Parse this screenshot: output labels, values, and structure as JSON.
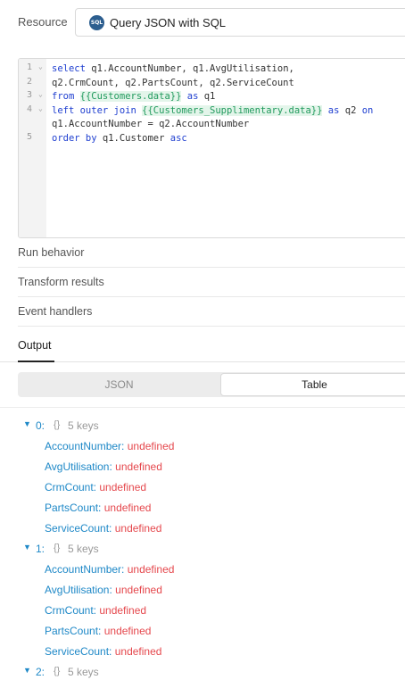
{
  "resource": {
    "label": "Resource",
    "badge": "SQL",
    "name": "Query JSON with SQL"
  },
  "editor": {
    "lines": [
      {
        "num": "1",
        "fold": "⌄"
      },
      {
        "num": "2",
        "fold": ""
      },
      {
        "num": "3",
        "fold": "⌄"
      },
      {
        "num": "4",
        "fold": "⌄"
      },
      {
        "num": "5",
        "fold": ""
      }
    ],
    "code": {
      "l1_kw": "select",
      "l1_rest": " q1.AccountNumber, q1.AvgUtilisation,",
      "l2": "q2.CrmCount, q2.PartsCount, q2.ServiceCount",
      "l3_kw": "from",
      "l3_tpl": "{{Customers.data}}",
      "l3_kw2": "as",
      "l3_rest": " q1",
      "l4_kw": "left outer join",
      "l4_tpl": "{{Customers_Supplimentary.data}}",
      "l4_kw2": "as",
      "l4_mid": " q2 ",
      "l4_kw3": "on",
      "l4b": "q1.AccountNumber = q2.AccountNumber",
      "l5_kw": "order by",
      "l5_mid": " q1.Customer ",
      "l5_kw2": "asc"
    }
  },
  "sections": {
    "run_behavior": "Run behavior",
    "transform_results": "Transform results",
    "event_handlers": "Event handlers"
  },
  "output": {
    "tab": "Output",
    "toggle_json": "JSON",
    "toggle_table": "Table"
  },
  "tree": {
    "arrow": "▼",
    "braces": "{}",
    "items": [
      {
        "index": "0:",
        "keys": "5 keys",
        "props": [
          {
            "name": "AccountNumber:",
            "value": "undefined"
          },
          {
            "name": "AvgUtilisation:",
            "value": "undefined"
          },
          {
            "name": "CrmCount:",
            "value": "undefined"
          },
          {
            "name": "PartsCount:",
            "value": "undefined"
          },
          {
            "name": "ServiceCount:",
            "value": "undefined"
          }
        ]
      },
      {
        "index": "1:",
        "keys": "5 keys",
        "props": [
          {
            "name": "AccountNumber:",
            "value": "undefined"
          },
          {
            "name": "AvgUtilisation:",
            "value": "undefined"
          },
          {
            "name": "CrmCount:",
            "value": "undefined"
          },
          {
            "name": "PartsCount:",
            "value": "undefined"
          },
          {
            "name": "ServiceCount:",
            "value": "undefined"
          }
        ]
      },
      {
        "index": "2:",
        "keys": "5 keys",
        "props": []
      }
    ]
  }
}
